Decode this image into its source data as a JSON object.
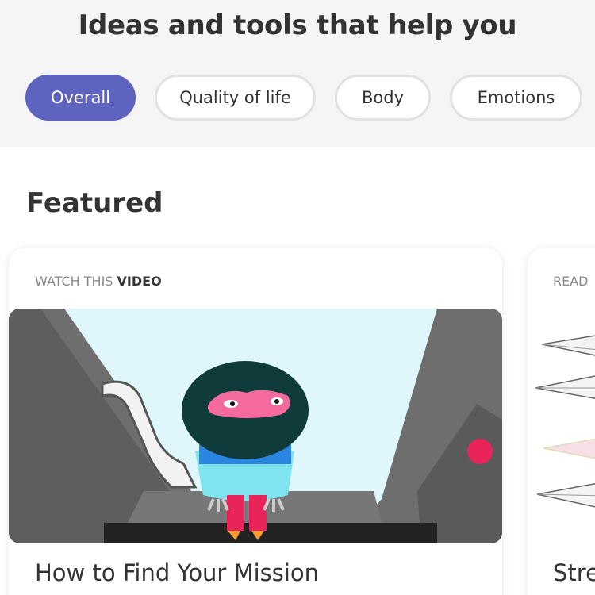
{
  "header": {
    "title": "Ideas and tools that help you"
  },
  "filters": [
    {
      "label": "Overall",
      "active": true
    },
    {
      "label": "Quality of life",
      "active": false
    },
    {
      "label": "Body",
      "active": false
    },
    {
      "label": "Emotions",
      "active": false
    }
  ],
  "featured": {
    "heading": "Featured",
    "cards": [
      {
        "label_prefix": "WATCH THIS ",
        "label_emphasis": "VIDEO",
        "title": "How to Find Your Mission",
        "icon": "video-thumbnail"
      },
      {
        "label_prefix": "READ",
        "label_emphasis": "",
        "title": "Stre",
        "icon": "paper-planes-image"
      }
    ]
  },
  "colors": {
    "accent": "#5d63bf",
    "background_top": "#f5f5f5",
    "text": "#333333"
  }
}
